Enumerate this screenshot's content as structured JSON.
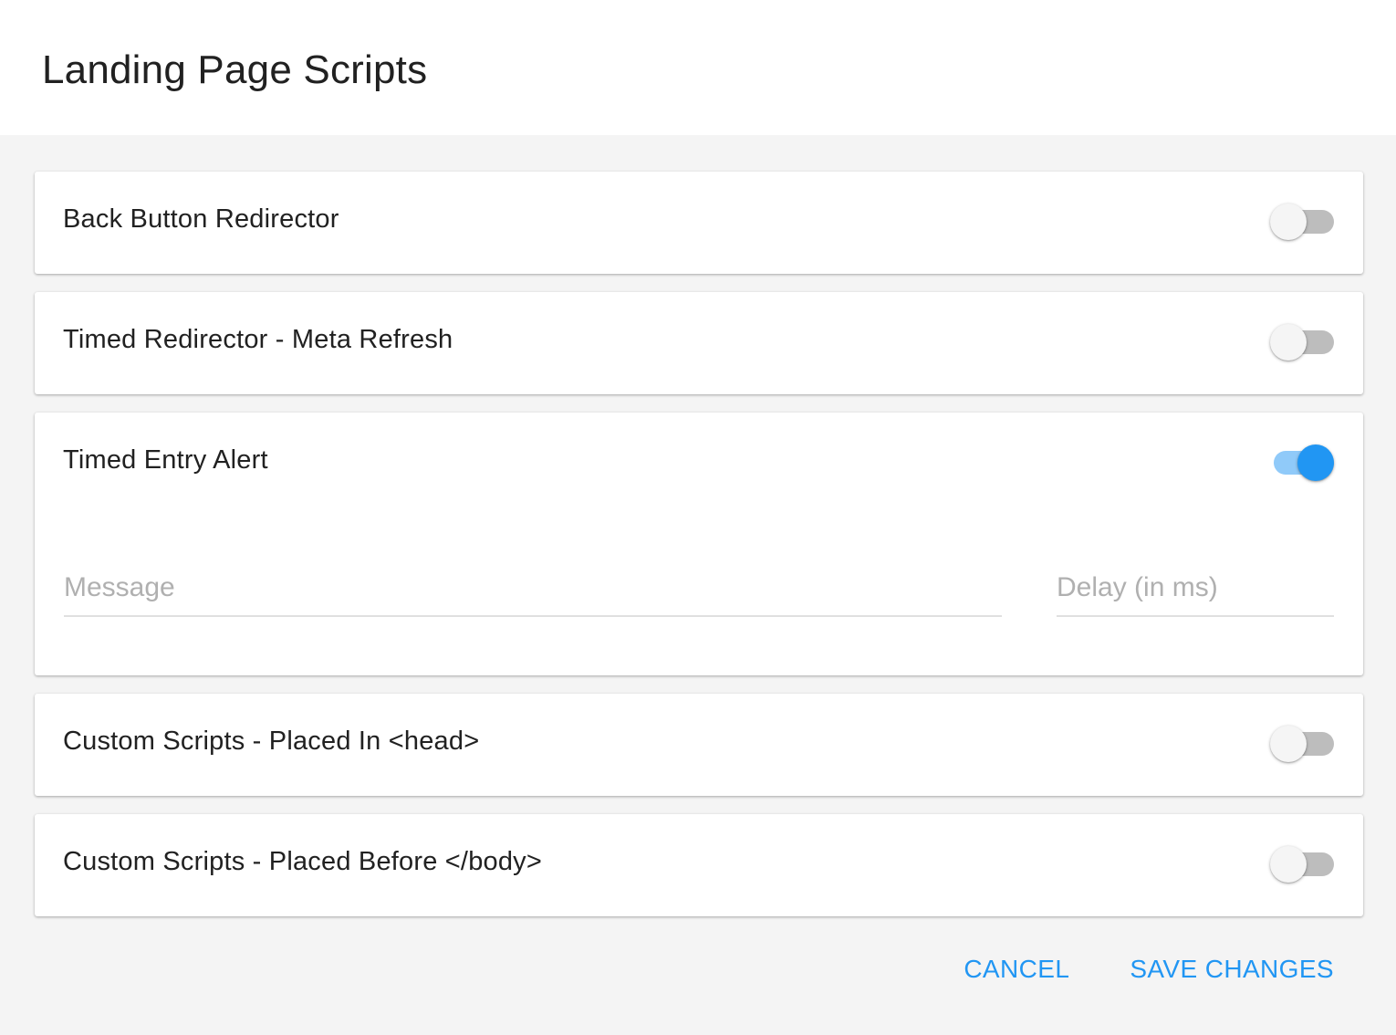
{
  "dialog": {
    "title": "Landing Page Scripts"
  },
  "panels": [
    {
      "label": "Back Button Redirector",
      "enabled": false
    },
    {
      "label": "Timed Redirector - Meta Refresh",
      "enabled": false
    },
    {
      "label": "Timed Entry Alert",
      "enabled": true
    },
    {
      "label": "Custom Scripts - Placed In <head>",
      "enabled": false
    },
    {
      "label": "Custom Scripts - Placed Before </body>",
      "enabled": false
    }
  ],
  "timed_entry_alert": {
    "message": {
      "placeholder": "Message",
      "value": ""
    },
    "delay": {
      "placeholder": "Delay (in ms)",
      "value": ""
    }
  },
  "actions": {
    "cancel_label": "CANCEL",
    "save_label": "SAVE CHANGES"
  },
  "colors": {
    "accent": "#2196f3",
    "toggle_on_track": "#90caf9",
    "toggle_off_track": "#bdbdbd",
    "background": "#f4f4f4"
  }
}
